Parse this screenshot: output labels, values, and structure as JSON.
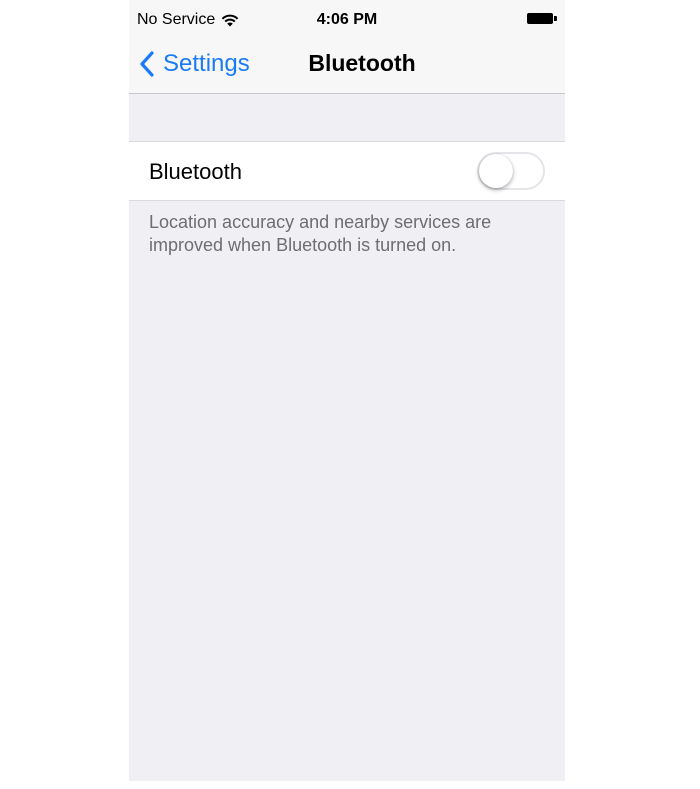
{
  "status_bar": {
    "carrier": "No Service",
    "wifi_icon": "wifi-icon",
    "time": "4:06 PM",
    "battery_icon": "battery-icon"
  },
  "nav": {
    "back_label": "Settings",
    "back_icon": "chevron-left-icon",
    "title": "Bluetooth"
  },
  "bluetooth_row": {
    "label": "Bluetooth",
    "toggle_on": false
  },
  "footer": {
    "line1": "Location accuracy and nearby services are",
    "line2": "improved when Bluetooth is turned on."
  },
  "colors": {
    "accent": "#1a7cf5",
    "background": "#efeff4",
    "secondary_text": "#6d6d72"
  }
}
